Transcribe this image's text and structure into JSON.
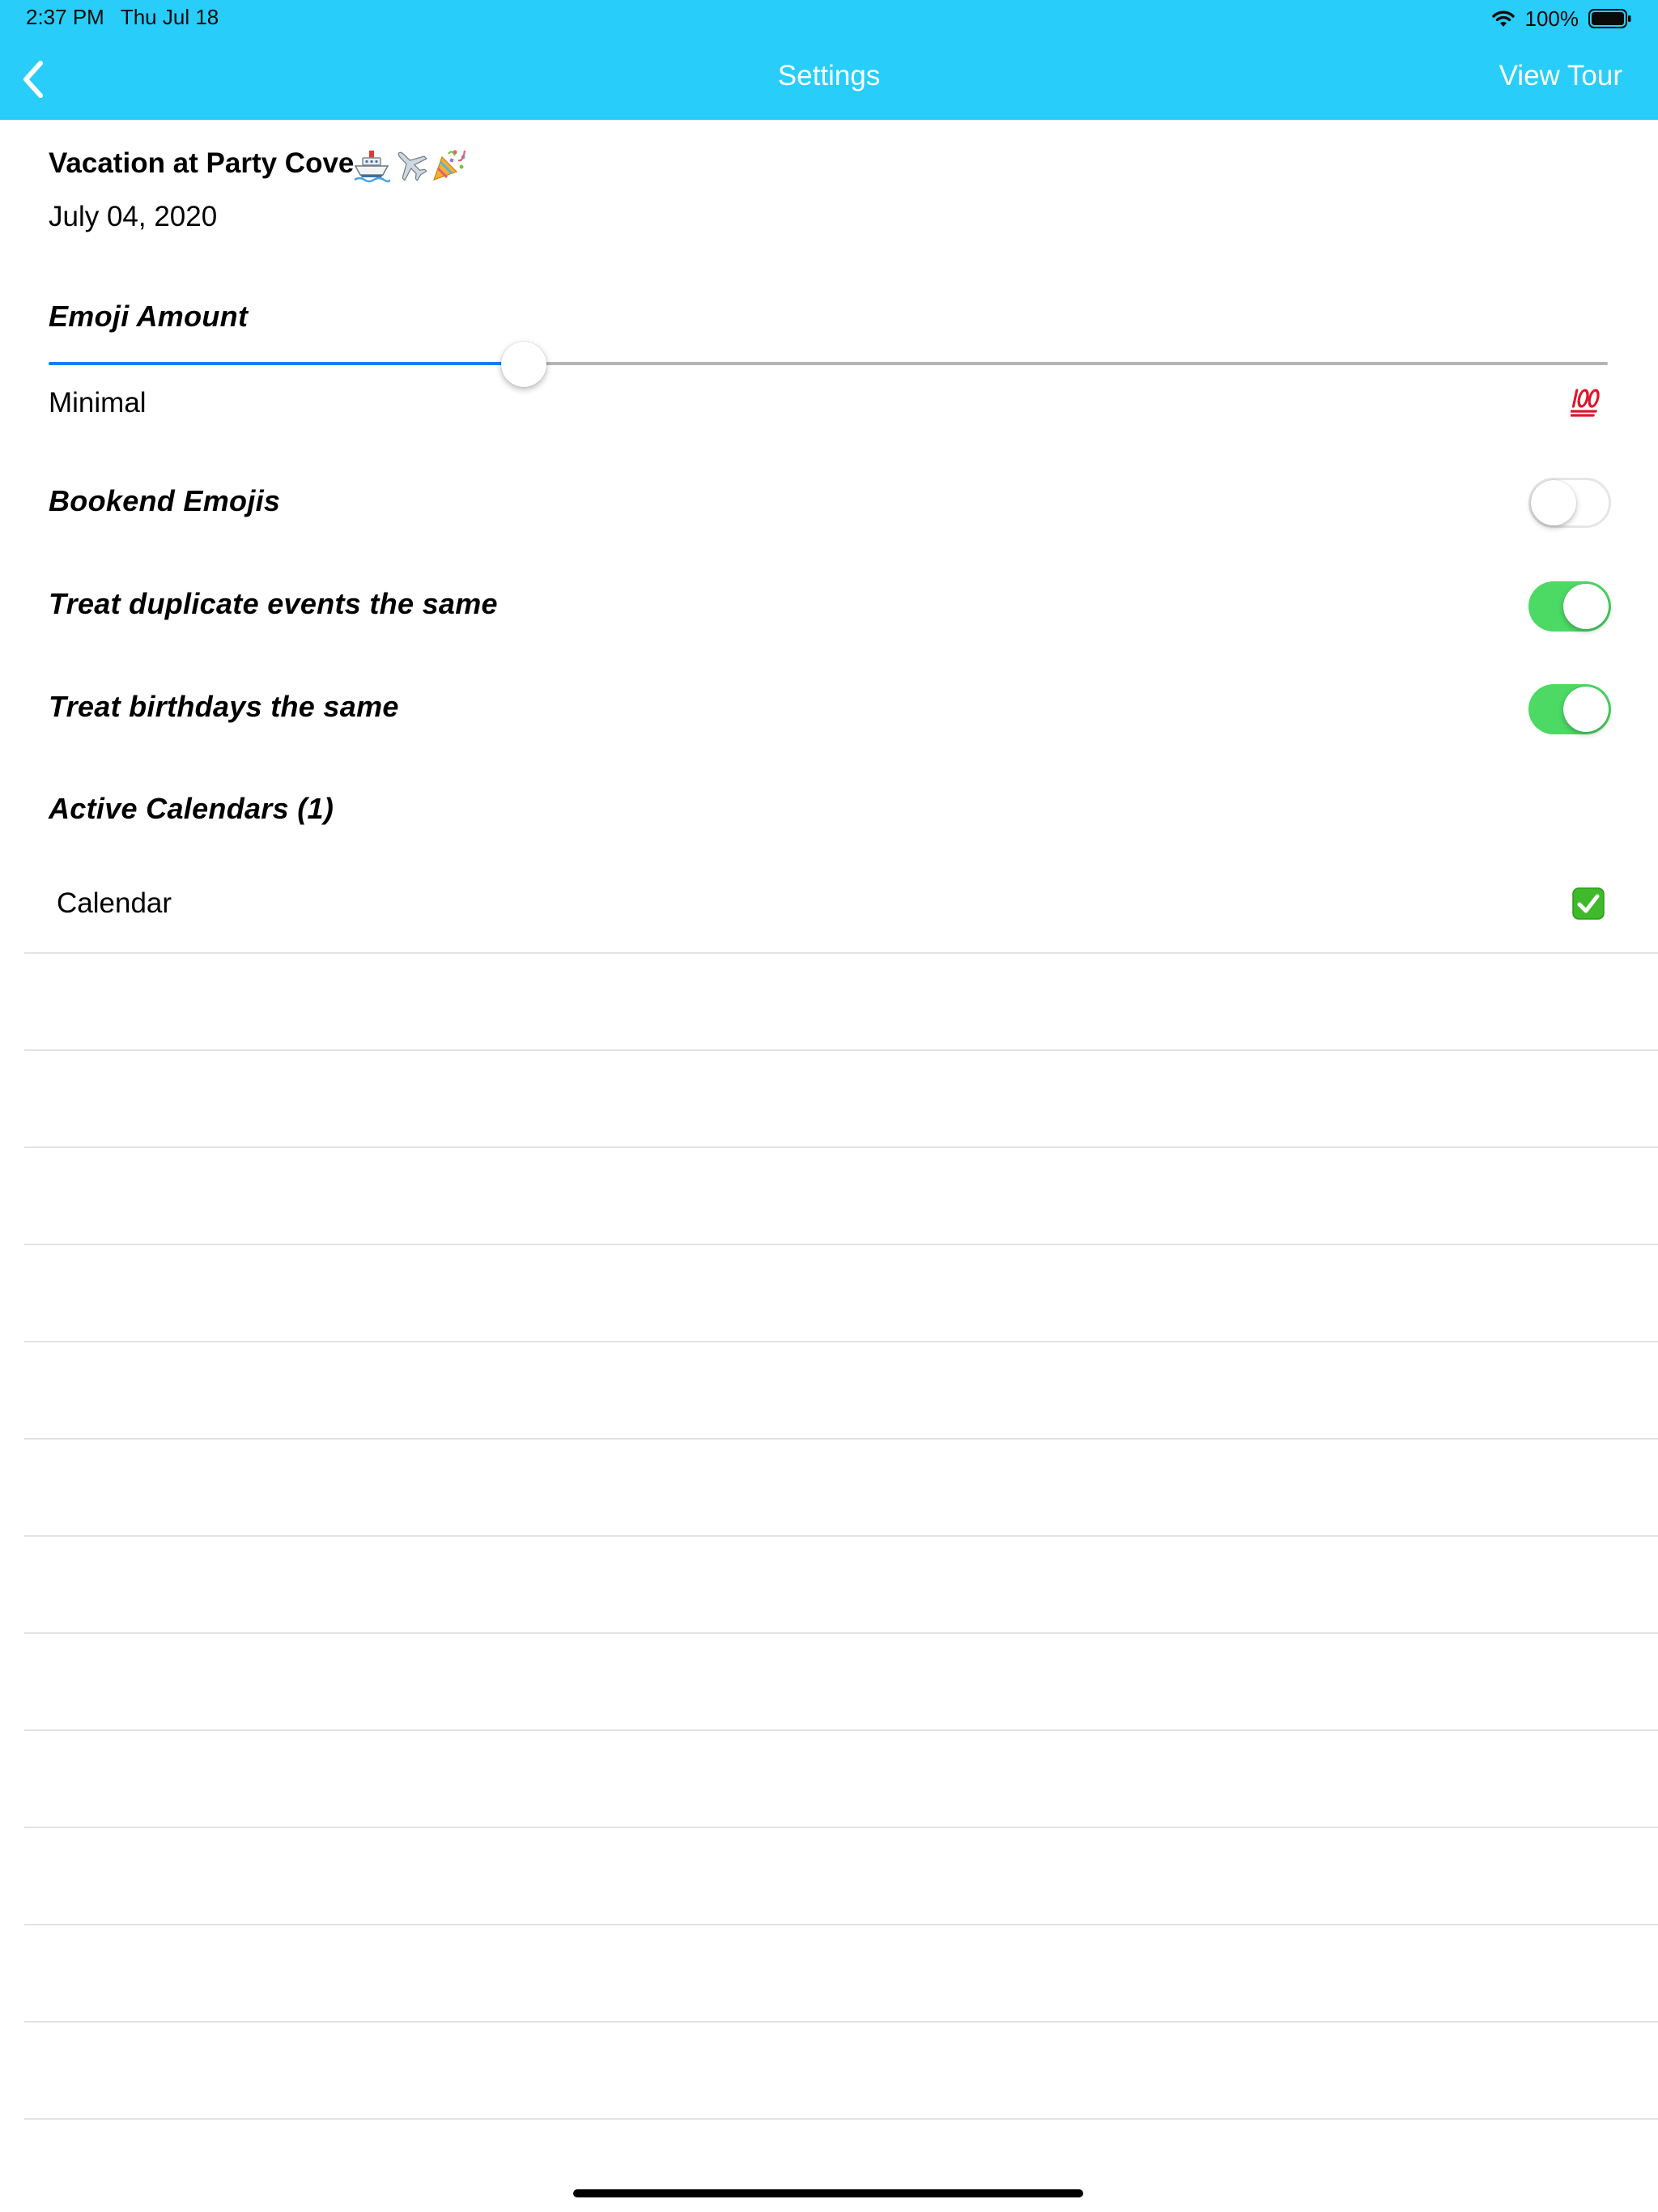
{
  "status_bar": {
    "time": "2:37 PM",
    "date": "Thu Jul 18",
    "battery": "100%"
  },
  "nav": {
    "title": "Settings",
    "right_button": "View Tour",
    "back_icon": "chevron-left-icon",
    "bar_color": "#28cdfa"
  },
  "event": {
    "title": "Vacation at Party Cove",
    "emojis": [
      "ship-icon",
      "airplane-icon",
      "party-popper-icon"
    ],
    "date": "July 04, 2020"
  },
  "emoji_amount": {
    "heading": "Emoji Amount",
    "min_label": "Minimal",
    "max_icon": "hundred-points-icon",
    "value": 0.305
  },
  "toggles": [
    {
      "label": "Bookend Emojis",
      "on": false
    },
    {
      "label": "Treat duplicate events the same",
      "on": true
    },
    {
      "label": "Treat birthdays the same",
      "on": true
    }
  ],
  "calendars": {
    "heading": "Active Calendars (1)",
    "items": [
      {
        "label": "Calendar",
        "checked": true,
        "icon": "check-mark-button-icon"
      }
    ]
  },
  "colors": {
    "accent": "#1d7cf2",
    "toggle_on": "#4cd964",
    "check_green": "#3fba2a"
  }
}
